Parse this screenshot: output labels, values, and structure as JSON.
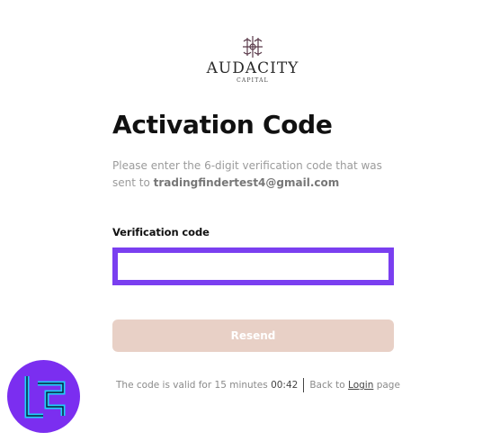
{
  "logo": {
    "name": "AUDACITY",
    "subtitle": "CAPITAL"
  },
  "page": {
    "title": "Activation Code",
    "description_prefix": "Please enter the 6-digit verification code that was sent to ",
    "email": "tradingfindertest4@gmail.com"
  },
  "form": {
    "label": "Verification code",
    "value": "",
    "resend_label": "Resend"
  },
  "footer": {
    "valid_text": "The code is valid for 15 minutes ",
    "timer": "00:42",
    "back_text": "Back to ",
    "login_label": "Login",
    "page_text": " page"
  },
  "colors": {
    "accent": "#7a3ff0",
    "button_disabled": "#e8d0c6",
    "badge": "#7b2ef0",
    "badge_icon": "#1fd0f5"
  },
  "icons": {
    "logo_mark": "monogram-crest-icon",
    "badge": "tf-logo-icon"
  }
}
